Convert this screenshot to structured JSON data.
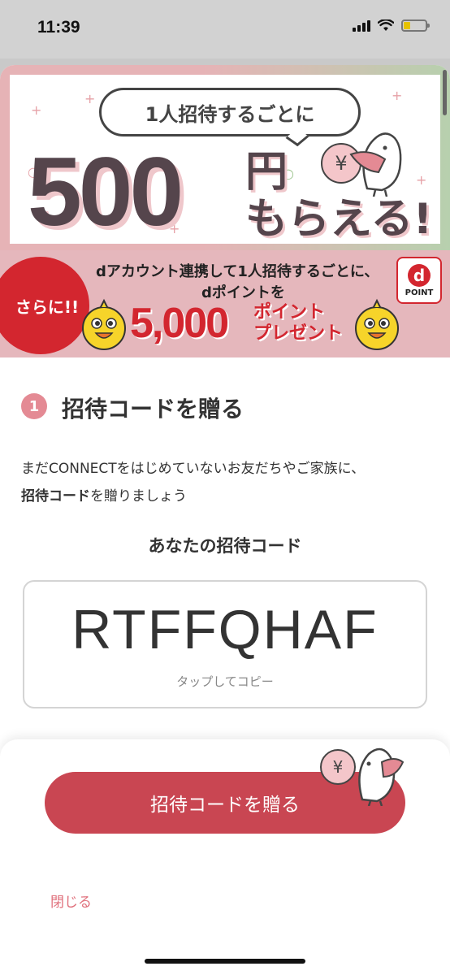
{
  "status": {
    "time": "11:39"
  },
  "banner_top": {
    "bubble_text": "1人招待するごとに",
    "amount": "500",
    "unit": "円",
    "receive": "もらえる!",
    "coin_symbol": "¥"
  },
  "banner_sub": {
    "badge": "さらに!!",
    "line1": "dアカウント連携して1人招待するごとに、",
    "line2": "dポイントを",
    "points": "5,000",
    "points_label_1": "ポイント",
    "points_label_2": "プレゼント",
    "logo_letter": "d",
    "logo_text": "POINT"
  },
  "section": {
    "step_number": "1",
    "title": "招待コードを贈る",
    "description_line1": "まだCONNECTをはじめていないお友だちやご家族に、",
    "description_bold": "招待コード",
    "description_rest": "を贈りましょう"
  },
  "invite_code": {
    "label": "あなたの招待コード",
    "value": "RTFFQHAF",
    "hint": "タップしてコピー"
  },
  "footer": {
    "send_button": "招待コードを贈る",
    "coin_symbol": "¥",
    "close_link": "閉じる"
  },
  "colors": {
    "accent": "#c94652",
    "step_badge": "#e48a94",
    "sub_banner": "#e5b7bc",
    "red": "#d3262f"
  }
}
